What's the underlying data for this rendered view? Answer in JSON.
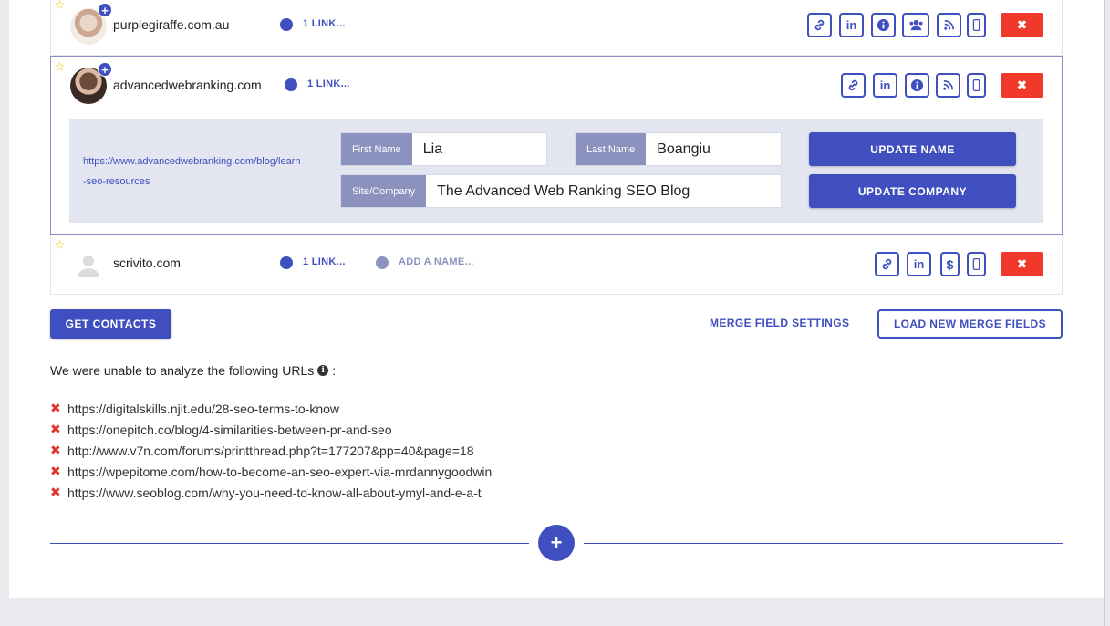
{
  "contacts": [
    {
      "domain": "purplegiraffe.com.au",
      "links": "1 LINK...",
      "icons": [
        "link-icon",
        "linkedin-icon",
        "info-icon",
        "users-icon",
        "rss-icon",
        "mobile-icon"
      ]
    },
    {
      "domain": "advancedwebranking.com",
      "links": "1 LINK...",
      "icons": [
        "link-icon",
        "linkedin-icon",
        "info-icon",
        "rss-icon",
        "mobile-icon"
      ],
      "url": "https://www.advancedwebranking.com/blog/learn-seo-resources",
      "first_name_label": "First Name",
      "first_name": "Lia",
      "last_name_label": "Last Name",
      "last_name": "Boangiu",
      "company_label": "Site/Company",
      "company": "The Advanced Web Ranking SEO Blog",
      "update_name": "UPDATE NAME",
      "update_company": "UPDATE COMPANY"
    },
    {
      "domain": "scrivito.com",
      "links": "1 LINK...",
      "add_name": "ADD A NAME...",
      "icons": [
        "link-icon",
        "linkedin-icon",
        "dollar-icon",
        "mobile-icon"
      ]
    }
  ],
  "actions": {
    "get_contacts": "GET CONTACTS",
    "merge_settings": "MERGE FIELD SETTINGS",
    "load_merge": "LOAD NEW MERGE FIELDS"
  },
  "failures": {
    "heading": "We were unable to analyze the following URLs",
    "urls": [
      "https://digitalskills.njit.edu/28-seo-terms-to-know",
      "https://onepitch.co/blog/4-similarities-between-pr-and-seo",
      "http://www.v7n.com/forums/printthread.php?t=177207&pp=40&page=18",
      "https://wpepitome.com/how-to-become-an-seo-expert-via-mrdannygoodwin",
      "https://www.seoblog.com/why-you-need-to-know-all-about-ymyl-and-e-a-t"
    ]
  },
  "colors": {
    "accent": "#3f4fbf",
    "danger": "#f0392b",
    "label_bg": "#8b92bd",
    "edit_bg": "#e3e5f1"
  }
}
